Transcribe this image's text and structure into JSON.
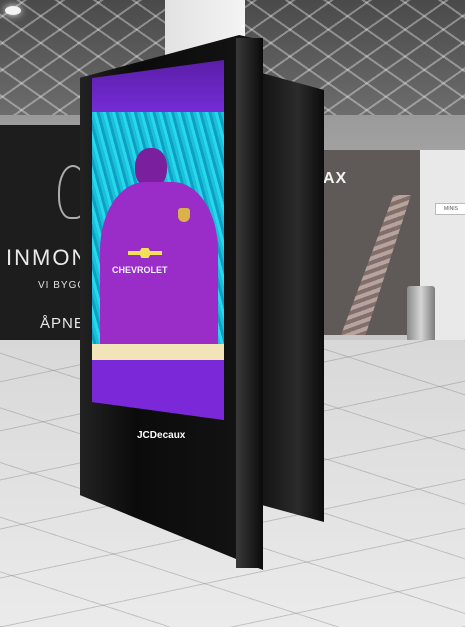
{
  "scene": {
    "hoarding": {
      "title": "INMON",
      "subtitle": "VI BYGGER",
      "opening": "ÅPNER"
    },
    "shop": {
      "sign": "AX"
    },
    "store_sign": "MINIS",
    "kiosk": {
      "brand": "JCDecaux",
      "screen": {
        "sponsor": "CHEVROLET"
      }
    }
  }
}
